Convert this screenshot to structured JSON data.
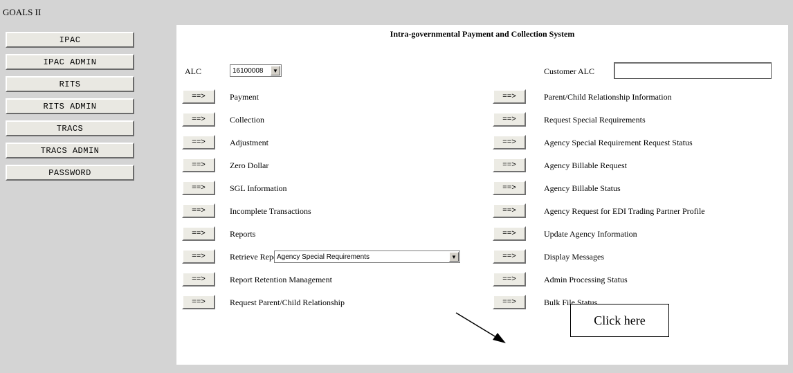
{
  "app": {
    "title": "GOALS II"
  },
  "nav": [
    {
      "label": "IPAC"
    },
    {
      "label": "IPAC ADMIN"
    },
    {
      "label": "RITS"
    },
    {
      "label": "RITS ADMIN"
    },
    {
      "label": "TRACS"
    },
    {
      "label": "TRACS ADMIN"
    },
    {
      "label": "PASSWORD"
    }
  ],
  "panel": {
    "title": "Intra-governmental Payment and Collection System",
    "alc_label": "ALC",
    "alc_value": "16100008",
    "customer_alc_label": "Customer ALC",
    "customer_alc_value": "",
    "button_label": "==>",
    "reports_label": "Reports",
    "reports_selected": "Agency Special Requirements",
    "left_items": [
      "Payment",
      "Collection",
      "Adjustment",
      "Zero Dollar",
      "SGL Information",
      "Incomplete Transactions",
      "Reports",
      "Retrieve Report/Data Files",
      "Report Retention Management",
      "Request Parent/Child Relationship"
    ],
    "right_items": [
      "Parent/Child Relationship Information",
      "Request Special Requirements",
      "Agency Special Requirement Request Status",
      "Agency Billable Request",
      "Agency Billable Status",
      "Agency Request for EDI Trading Partner Profile",
      "Update Agency Information",
      "Display Messages",
      "Admin Processing Status",
      "Bulk File Status"
    ]
  },
  "annotation": {
    "callout_text": "Click here"
  }
}
